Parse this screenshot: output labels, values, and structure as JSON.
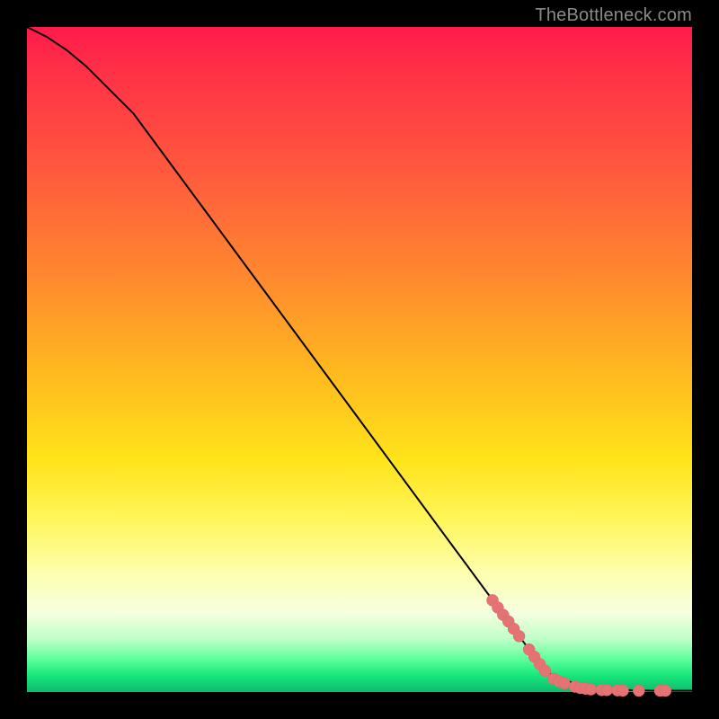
{
  "watermark": "TheBottleneck.com",
  "chart_data": {
    "type": "line",
    "title": "",
    "xlabel": "",
    "ylabel": "",
    "xlim": [
      0,
      100
    ],
    "ylim": [
      0,
      100
    ],
    "series": [
      {
        "name": "curve",
        "x": [
          0,
          3,
          6,
          9,
          12,
          16,
          78,
          82,
          86,
          90,
          94,
          100
        ],
        "y": [
          100,
          98.5,
          96.5,
          94,
          91,
          87,
          3,
          1.4,
          0.6,
          0.3,
          0.2,
          0.2
        ]
      }
    ],
    "scatter": {
      "name": "highlighted-points",
      "color": "#e57373",
      "points": [
        {
          "x": 70.0,
          "y": 13.8
        },
        {
          "x": 70.8,
          "y": 12.7
        },
        {
          "x": 71.6,
          "y": 11.6
        },
        {
          "x": 72.4,
          "y": 10.6
        },
        {
          "x": 73.2,
          "y": 9.5
        },
        {
          "x": 74.0,
          "y": 8.4
        },
        {
          "x": 75.5,
          "y": 6.4
        },
        {
          "x": 76.3,
          "y": 5.3
        },
        {
          "x": 77.1,
          "y": 4.2
        },
        {
          "x": 77.9,
          "y": 3.2
        },
        {
          "x": 79.2,
          "y": 2.0
        },
        {
          "x": 80.0,
          "y": 1.6
        },
        {
          "x": 80.8,
          "y": 1.3
        },
        {
          "x": 82.4,
          "y": 0.8
        },
        {
          "x": 83.2,
          "y": 0.6
        },
        {
          "x": 84.0,
          "y": 0.5
        },
        {
          "x": 84.8,
          "y": 0.4
        },
        {
          "x": 86.4,
          "y": 0.3
        },
        {
          "x": 87.2,
          "y": 0.3
        },
        {
          "x": 88.8,
          "y": 0.25
        },
        {
          "x": 89.6,
          "y": 0.22
        },
        {
          "x": 92.0,
          "y": 0.2
        },
        {
          "x": 95.2,
          "y": 0.2
        },
        {
          "x": 96.0,
          "y": 0.2
        }
      ]
    }
  }
}
